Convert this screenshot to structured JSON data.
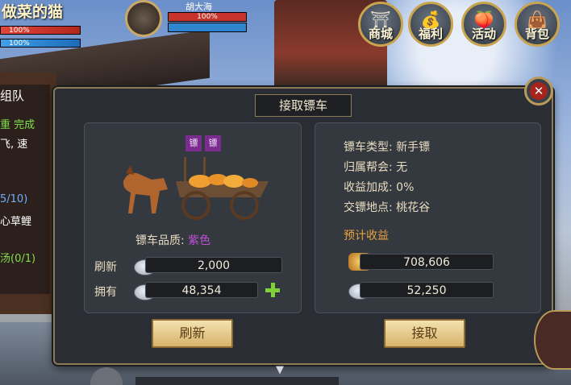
{
  "hud": {
    "player_name": "做菜的猫",
    "hp": "100%",
    "mp": "100%",
    "target_name": "胡大海",
    "target_hp": "100%"
  },
  "top_menu": [
    {
      "label": "商城",
      "icon": "shop-icon"
    },
    {
      "label": "福利",
      "icon": "gift-icon"
    },
    {
      "label": "活动",
      "icon": "event-icon"
    },
    {
      "label": "背包",
      "icon": "bag-icon"
    }
  ],
  "side_panel": {
    "title": "组队",
    "lines": [
      {
        "text": "重 完成",
        "color": "#7fe04a"
      },
      {
        "text": "飞, 速",
        "color": "#ffffff"
      },
      {
        "text": "5/10)",
        "color": "#6fb0ff"
      },
      {
        "text": "心草鲤",
        "color": "#ffffff"
      },
      {
        "text": "汤(0/1)",
        "color": "#7fe04a"
      }
    ]
  },
  "dialog": {
    "title": "接取镖车",
    "flags": [
      "镖",
      "镖"
    ],
    "quality_label": "镖车品质:",
    "quality_value": "紫色",
    "refresh_label": "刷新",
    "refresh_cost": "2,000",
    "own_label": "拥有",
    "own_amount": "48,354",
    "info": [
      {
        "key": "镖车类型:",
        "value": "新手镖"
      },
      {
        "key": "归属帮会:",
        "value": "无"
      },
      {
        "key": "收益加成:",
        "value": "0%"
      },
      {
        "key": "交镖地点:",
        "value": "桃花谷"
      }
    ],
    "estimated_label": "预计收益",
    "reward_gold": "708,606",
    "reward_silver": "52,250",
    "refresh_button": "刷新",
    "accept_button": "接取"
  },
  "colors": {
    "quality_purple": "#c04fd6",
    "estimate_orange": "#e7a340",
    "button_gold": "#e6c98a"
  }
}
